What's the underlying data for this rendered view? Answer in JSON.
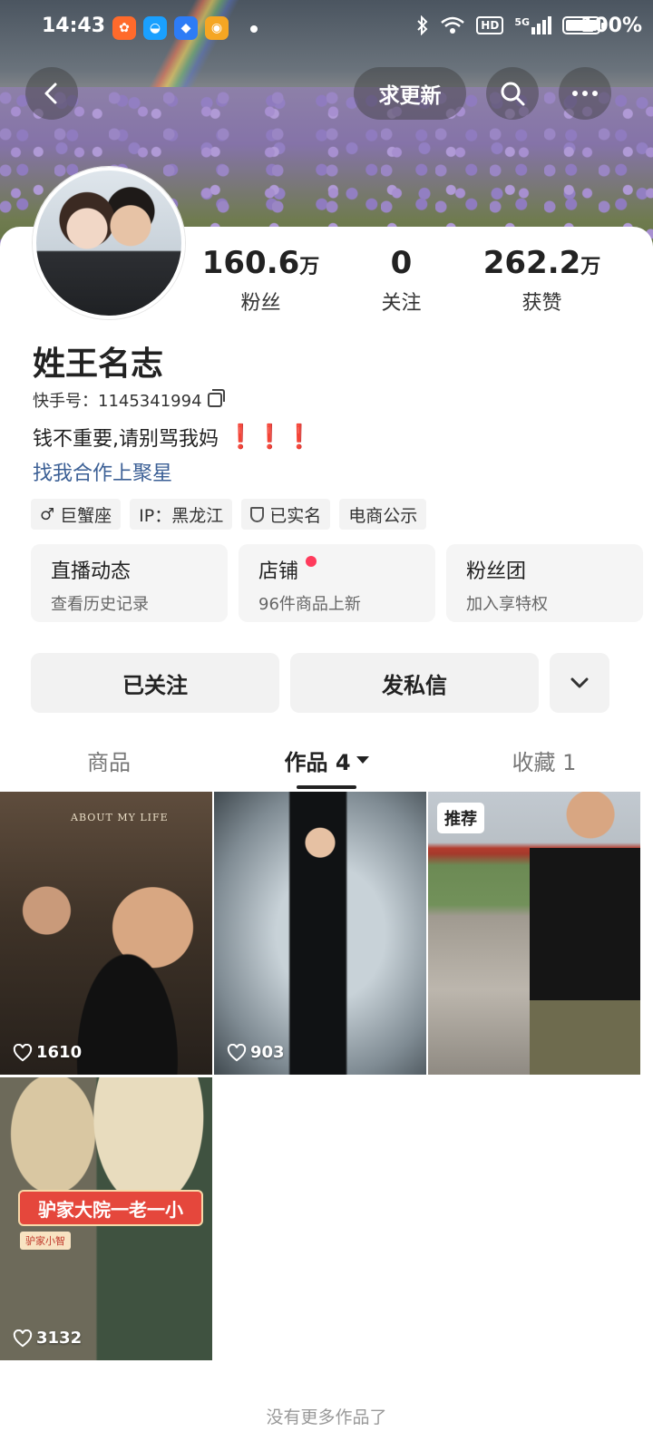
{
  "status_bar": {
    "time": "14:43",
    "network_badge": "HD",
    "signal": "5G",
    "battery": "100%"
  },
  "nav": {
    "update_label": "求更新"
  },
  "profile": {
    "name": "姓王名志",
    "kuaishou_id": "快手号：1145341994",
    "bio": "钱不重要,请别骂我妈",
    "bio_marks": "❗❗❗",
    "bio_link": "找我合作上聚星"
  },
  "stats": [
    {
      "value": "160.6",
      "unit": "万",
      "label": "粉丝"
    },
    {
      "value": "0",
      "unit": "",
      "label": "关注"
    },
    {
      "value": "262.2",
      "unit": "万",
      "label": "获赞"
    }
  ],
  "tags": {
    "zodiac": "巨蟹座",
    "zodiac_icon": "♂",
    "ip": "IP：黑龙江",
    "verified": "已实名",
    "ecommerce": "电商公示"
  },
  "features": [
    {
      "title": "直播动态",
      "subtitle": "查看历史记录"
    },
    {
      "title": "店铺",
      "subtitle": "96件商品上新"
    },
    {
      "title": "粉丝团",
      "subtitle": "加入享特权"
    }
  ],
  "actions": {
    "followed": "已关注",
    "message": "发私信"
  },
  "tabs": {
    "goods": "商品",
    "works": "作品 4",
    "favorites": "收藏 1"
  },
  "videos": [
    {
      "likes": "1610",
      "overlay": "ABOUT MY LIFE"
    },
    {
      "likes": "903"
    },
    {
      "badge": "推荐"
    },
    {
      "likes": "3132",
      "caption": "驴家大院一老一小",
      "tag": "驴家小智"
    }
  ],
  "footer": {
    "no_more": "没有更多作品了"
  },
  "colors": {
    "accent_red": "#ff3b5c",
    "link_blue": "#3b5f95",
    "bang_red": "#e0283a"
  }
}
